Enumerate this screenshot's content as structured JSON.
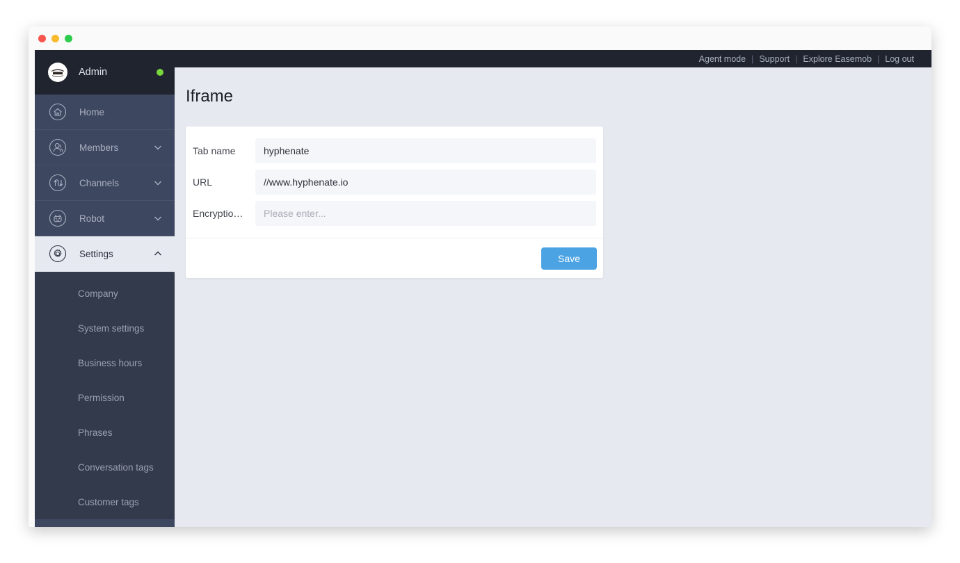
{
  "window": {
    "traffic_lights": [
      "close",
      "minimize",
      "maximize"
    ]
  },
  "sidebar": {
    "user": {
      "name": "Admin",
      "avatar_icon": "avatar-image",
      "status_icon": "online-status-dot",
      "status_color": "#76d63c"
    },
    "nav_items": [
      {
        "label": "Home",
        "icon": "home-icon",
        "chevron": null,
        "active": false
      },
      {
        "label": "Members",
        "icon": "members-icon",
        "chevron": "chevron-down-icon",
        "active": false
      },
      {
        "label": "Channels",
        "icon": "channels-icon",
        "chevron": "chevron-down-icon",
        "active": false
      },
      {
        "label": "Robot",
        "icon": "robot-icon",
        "chevron": "chevron-down-icon",
        "active": false
      },
      {
        "label": "Settings",
        "icon": "gear-icon",
        "chevron": "chevron-up-icon",
        "active": true
      }
    ],
    "submenu_items": [
      {
        "label": "Company"
      },
      {
        "label": "System settings"
      },
      {
        "label": "Business hours"
      },
      {
        "label": "Permission"
      },
      {
        "label": "Phrases"
      },
      {
        "label": "Conversation tags"
      },
      {
        "label": "Customer tags"
      }
    ]
  },
  "topbar": {
    "links": [
      "Agent mode",
      "Support",
      "Explore Easemob",
      "Log out"
    ],
    "separator": "|"
  },
  "main": {
    "page_title": "Iframe",
    "form": {
      "fields": [
        {
          "label": "Tab name",
          "value": "hyphenate",
          "placeholder": "Please enter..."
        },
        {
          "label": "URL",
          "value": "//www.hyphenate.io",
          "placeholder": "Please enter..."
        },
        {
          "label": "Encryptio…",
          "value": "",
          "placeholder": "Please enter..."
        }
      ],
      "save_label": "Save",
      "save_color": "#4ba3e3"
    }
  },
  "colors": {
    "sidebar_header": "#20242e",
    "sidebar_nav": "#3e4760",
    "submenu": "#333a4c",
    "content_bg": "#e6e9f0",
    "card_bg": "#ffffff",
    "input_bg": "#f4f6fa",
    "accent": "#4ba3e3"
  }
}
